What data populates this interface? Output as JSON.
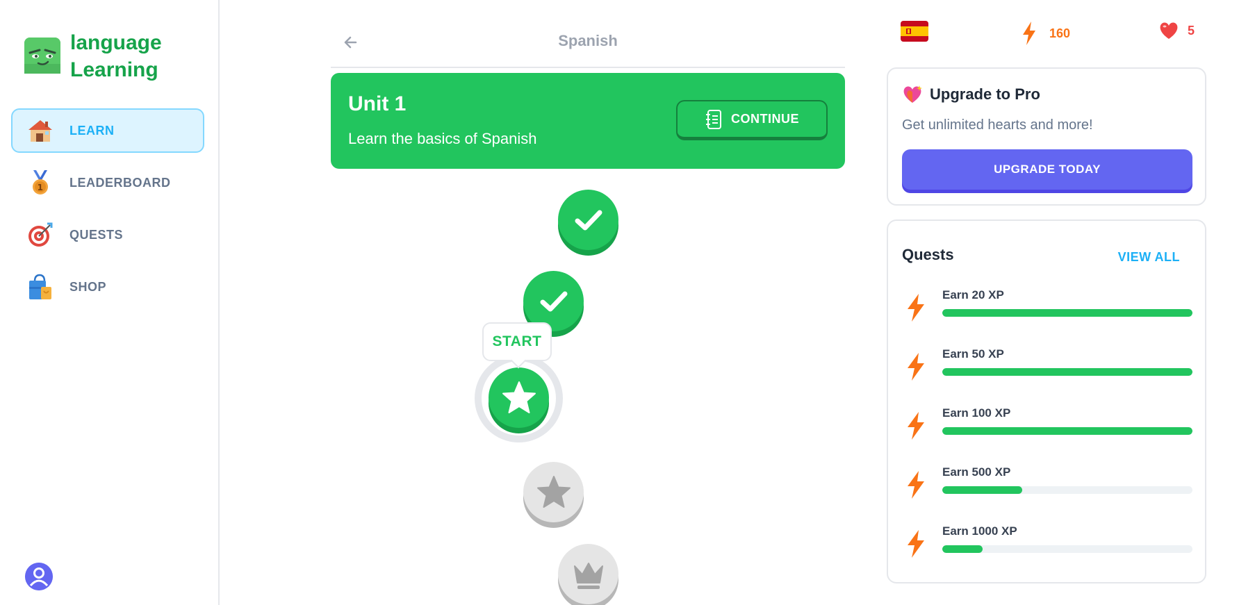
{
  "brand": {
    "line1": "language",
    "line2": "Learning"
  },
  "sidebar": {
    "items": [
      {
        "label": "LEARN",
        "icon": "house-icon",
        "active": true
      },
      {
        "label": "LEADERBOARD",
        "icon": "medal-icon",
        "active": false
      },
      {
        "label": "QUESTS",
        "icon": "target-icon",
        "active": false
      },
      {
        "label": "SHOP",
        "icon": "shopping-bag-icon",
        "active": false
      }
    ]
  },
  "header": {
    "title": "Spanish"
  },
  "unit": {
    "title": "Unit 1",
    "description": "Learn the basics of Spanish",
    "continue_label": "CONTINUE"
  },
  "path": {
    "start_label": "START",
    "lessons": [
      {
        "state": "completed",
        "icon": "check-icon"
      },
      {
        "state": "completed",
        "icon": "check-icon"
      },
      {
        "state": "current",
        "icon": "star-icon"
      },
      {
        "state": "locked",
        "icon": "star-icon"
      },
      {
        "state": "locked",
        "icon": "crown-icon"
      }
    ]
  },
  "stats": {
    "language_flag": "spain-flag-icon",
    "xp": "160",
    "hearts": "5",
    "xp_color": "#f97316",
    "hearts_color": "#ef4444"
  },
  "pro": {
    "title": "Upgrade to Pro",
    "subtitle": "Get unlimited hearts and more!",
    "button_label": "UPGRADE TODAY"
  },
  "quests": {
    "title": "Quests",
    "view_all_label": "VIEW ALL",
    "items": [
      {
        "label": "Earn 20 XP",
        "progress": 1.0
      },
      {
        "label": "Earn 50 XP",
        "progress": 1.0
      },
      {
        "label": "Earn 100 XP",
        "progress": 1.0
      },
      {
        "label": "Earn 500 XP",
        "progress": 0.32
      },
      {
        "label": "Earn 1000 XP",
        "progress": 0.16
      }
    ]
  },
  "colors": {
    "primary_green": "#22c55e",
    "accent_blue": "#1cb0f6",
    "pro_purple": "#6366f1"
  }
}
